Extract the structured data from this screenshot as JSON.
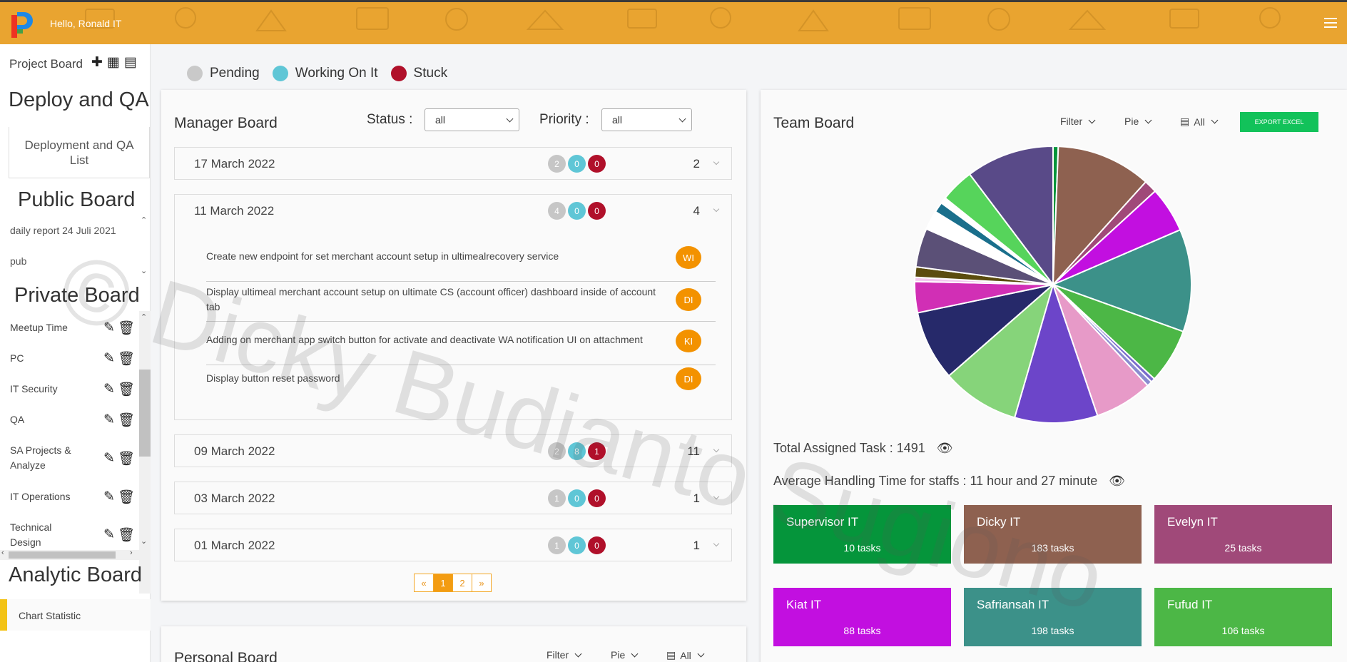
{
  "topbar": {
    "greeting": "Hello, Ronald IT"
  },
  "sidebar": {
    "project_board": "Project Board",
    "deploy_title": "Deploy and QA",
    "deploy_item": "Deployment and QA List",
    "public_title": "Public Board",
    "public_items": [
      "daily report 24 Juli 2021",
      "pub"
    ],
    "private_title": "Private Board",
    "private_items": [
      "Meetup Time",
      "PC",
      "IT Security",
      "QA",
      "SA Projects & Analyze",
      "IT Operations",
      "Technical Design"
    ],
    "analytic_title": "Analytic Board",
    "analytic_item": "Chart Statistic"
  },
  "legend": [
    {
      "label": "Pending",
      "color": "#c9c9c9"
    },
    {
      "label": "Working On It",
      "color": "#5fc6d6"
    },
    {
      "label": "Stuck",
      "color": "#b0102a"
    }
  ],
  "manager": {
    "title": "Manager Board",
    "status_label": "Status :",
    "status_value": "all",
    "priority_label": "Priority :",
    "priority_value": "all",
    "dates": [
      {
        "date": "17 March 2022",
        "pending": "2",
        "working": "0",
        "stuck": "0",
        "total": "2"
      },
      {
        "date": "11 March 2022",
        "pending": "4",
        "working": "0",
        "stuck": "0",
        "total": "4"
      },
      {
        "date": "09 March 2022",
        "pending": "2",
        "working": "8",
        "stuck": "1",
        "total": "11"
      },
      {
        "date": "03 March 2022",
        "pending": "1",
        "working": "0",
        "stuck": "0",
        "total": "1"
      },
      {
        "date": "01 March 2022",
        "pending": "1",
        "working": "0",
        "stuck": "0",
        "total": "1"
      }
    ],
    "tasks": [
      {
        "text": "Create new endpoint for set merchant account setup in ultimealrecovery service",
        "initials": "WI"
      },
      {
        "text": "Display ultimeal merchant account setup on ultimate CS (account officer) dashboard inside of account tab",
        "initials": "DI"
      },
      {
        "text": "Adding on merchant app switch button for activate and deactivate WA notification UI on attachment",
        "initials": "KI"
      },
      {
        "text": "Display button reset password",
        "initials": "DI"
      }
    ],
    "pager": [
      "«",
      "1",
      "2",
      "»"
    ]
  },
  "personal": {
    "title": "Personal Board",
    "filter": "Filter",
    "chart": "Pie",
    "range": "All"
  },
  "team": {
    "title": "Team Board",
    "filter": "Filter",
    "chart": "Pie",
    "range": "All",
    "export": "EXPORT EXCEL",
    "total": "Total Assigned Task : 1491",
    "average": "Average Handling Time for staffs : 11 hour and 27 minute",
    "tiles": [
      {
        "name": "Supervisor IT",
        "tasks": "10 tasks",
        "color": "#05953b"
      },
      {
        "name": "Dicky IT",
        "tasks": "183 tasks",
        "color": "#8e6150"
      },
      {
        "name": "Evelyn IT",
        "tasks": "25 tasks",
        "color": "#a04979"
      },
      {
        "name": "Kiat IT",
        "tasks": "88 tasks",
        "color": "#c20fe0"
      },
      {
        "name": "Safriansah IT",
        "tasks": "198 tasks",
        "color": "#3c9189"
      },
      {
        "name": "Fufud IT",
        "tasks": "106 tasks",
        "color": "#4cb746"
      }
    ]
  },
  "chart_data": {
    "type": "pie",
    "values": [
      10,
      183,
      25,
      88,
      198,
      106,
      8,
      10,
      112,
      160,
      150,
      135,
      60,
      8,
      20,
      75,
      37,
      20,
      12,
      65,
      170
    ],
    "colors": [
      "#05953b",
      "#8e6150",
      "#a04979",
      "#c20fe0",
      "#3c9189",
      "#4cb746",
      "#7a6bcc",
      "#8b8bd0",
      "#e79ac8",
      "#6c45c9",
      "#86d47a",
      "#26296a",
      "#d12fb5",
      "#f2c8ef",
      "#5b4c0e",
      "#5b5077",
      "#ffffff",
      "#1a6f8c",
      "#ffffff",
      "#56d45b",
      "#594a88"
    ]
  },
  "watermark": "© Dicky Budianto Sugiono"
}
